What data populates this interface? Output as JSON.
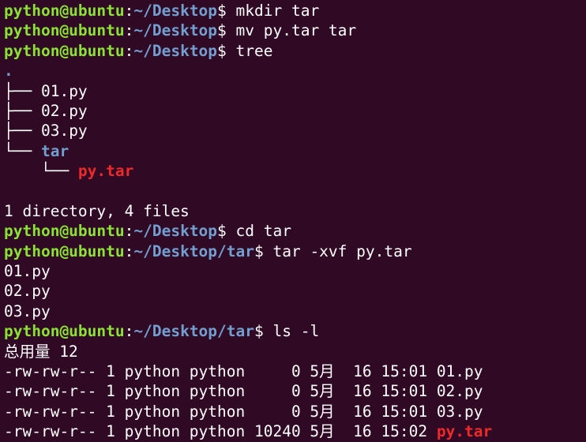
{
  "terminal": {
    "prompt": {
      "user_host": "python@ubuntu",
      "separator": ":",
      "dollar": "$ "
    },
    "session": [
      {
        "type": "prompt",
        "path": "~/Desktop",
        "command": "mkdir tar"
      },
      {
        "type": "prompt",
        "path": "~/Desktop",
        "command": "mv py.tar tar"
      },
      {
        "type": "prompt",
        "path": "~/Desktop",
        "command": "tree"
      },
      {
        "type": "tree-root",
        "text": "."
      },
      {
        "type": "tree-entry",
        "prefix": "├── ",
        "name": "01.py",
        "kind": "file"
      },
      {
        "type": "tree-entry",
        "prefix": "├── ",
        "name": "02.py",
        "kind": "file"
      },
      {
        "type": "tree-entry",
        "prefix": "├── ",
        "name": "03.py",
        "kind": "file"
      },
      {
        "type": "tree-entry",
        "prefix": "└── ",
        "name": "tar",
        "kind": "dir"
      },
      {
        "type": "tree-entry",
        "prefix": "    └── ",
        "name": "py.tar",
        "kind": "archive"
      },
      {
        "type": "blank"
      },
      {
        "type": "output",
        "text": "1 directory, 4 files"
      },
      {
        "type": "prompt",
        "path": "~/Desktop",
        "command": "cd tar"
      },
      {
        "type": "prompt",
        "path": "~/Desktop/tar",
        "command": "tar -xvf py.tar"
      },
      {
        "type": "output",
        "text": "01.py"
      },
      {
        "type": "output",
        "text": "02.py"
      },
      {
        "type": "output",
        "text": "03.py"
      },
      {
        "type": "prompt",
        "path": "~/Desktop/tar",
        "command": "ls -l"
      },
      {
        "type": "output",
        "text": "总用量 12"
      },
      {
        "type": "ls-entry",
        "meta": "-rw-rw-r-- 1 python python     0 5月  16 15:01 ",
        "name": "01.py",
        "kind": "file"
      },
      {
        "type": "ls-entry",
        "meta": "-rw-rw-r-- 1 python python     0 5月  16 15:01 ",
        "name": "02.py",
        "kind": "file"
      },
      {
        "type": "ls-entry",
        "meta": "-rw-rw-r-- 1 python python     0 5月  16 15:01 ",
        "name": "03.py",
        "kind": "file"
      },
      {
        "type": "ls-entry",
        "meta": "-rw-rw-r-- 1 python python 10240 5月  16 15:02 ",
        "name": "py.tar",
        "kind": "archive"
      }
    ]
  },
  "colors": {
    "background": "#300a24",
    "user_host": "#8ae234",
    "path": "#729fcf",
    "directory": "#729fcf",
    "archive": "#ef2929",
    "text": "#ffffff"
  }
}
